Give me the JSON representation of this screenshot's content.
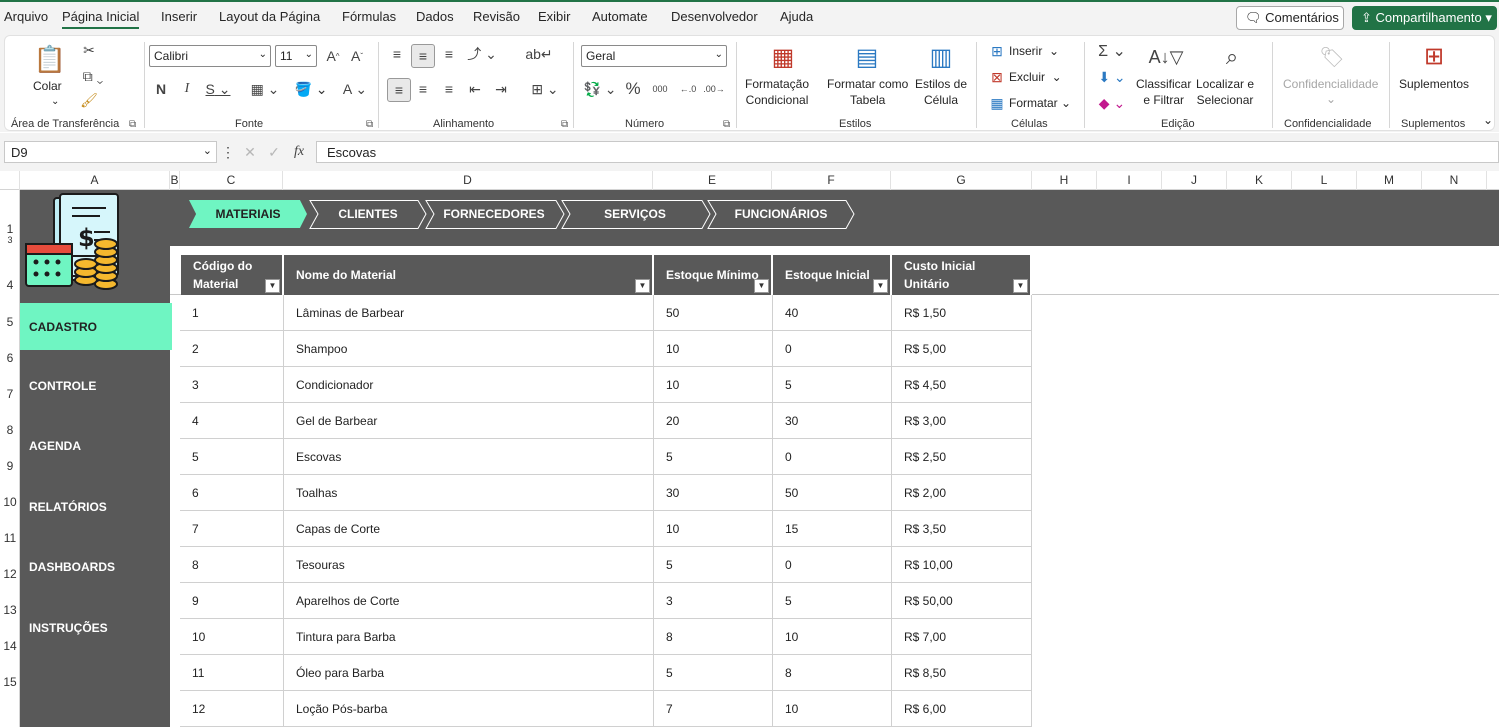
{
  "menu": {
    "items": [
      "Arquivo",
      "Página Inicial",
      "Inserir",
      "Layout da Página",
      "Fórmulas",
      "Dados",
      "Revisão",
      "Exibir",
      "Automate",
      "Desenvolvedor",
      "Ajuda"
    ],
    "active": "Página Inicial",
    "comments_label": "Comentários",
    "share_label": "Compartilhamento"
  },
  "ribbon": {
    "clipboard": {
      "paste": "Colar",
      "label": "Área de Transferência"
    },
    "font": {
      "name": "Calibri",
      "size": "11",
      "label": "Fonte",
      "bold": "N",
      "italic": "I",
      "underline": "S"
    },
    "alignment": {
      "label": "Alinhamento"
    },
    "number": {
      "format": "Geral",
      "label": "Número"
    },
    "styles": {
      "conditional": "Formatação\nCondicional",
      "as_table": "Formatar como\nTabela",
      "cell_styles": "Estilos de\nCélula",
      "label": "Estilos"
    },
    "cells": {
      "insert": "Inserir",
      "delete": "Excluir",
      "format": "Formatar",
      "label": "Células"
    },
    "editing": {
      "sort": "Classificar\ne Filtrar",
      "find": "Localizar e\nSelecionar",
      "label": "Edição"
    },
    "sensitivity": {
      "button": "Confidencialidade",
      "label": "Confidencialidade"
    },
    "addins": {
      "button": "Suplementos",
      "label": "Suplementos"
    }
  },
  "formula_bar": {
    "name_box": "D9",
    "value": "Escovas"
  },
  "columns": [
    "A",
    "B",
    "C",
    "D",
    "E",
    "F",
    "G",
    "H",
    "I",
    "J",
    "K",
    "L",
    "M",
    "N"
  ],
  "rows": [
    "1",
    "3",
    "4",
    "5",
    "6",
    "7",
    "8",
    "9",
    "10",
    "11",
    "12",
    "13",
    "14",
    "15"
  ],
  "nav_tabs": [
    "MATERIAIS",
    "CLIENTES",
    "FORNECEDORES",
    "SERVIÇOS",
    "FUNCIONÁRIOS"
  ],
  "active_tab": "MATERIAIS",
  "sidebar": [
    "CADASTRO",
    "CONTROLE",
    "AGENDA",
    "RELATÓRIOS",
    "DASHBOARDS",
    "INSTRUÇÕES"
  ],
  "active_sidebar": "CADASTRO",
  "table": {
    "headers": [
      "Código do Material",
      "Nome do Material",
      "Estoque Mínimo",
      "Estoque Inicial",
      "Custo Inicial Unitário"
    ],
    "rows": [
      [
        "1",
        "Lâminas de Barbear",
        "50",
        "40",
        "R$ 1,50"
      ],
      [
        "2",
        "Shampoo",
        "10",
        "0",
        "R$ 5,00"
      ],
      [
        "3",
        "Condicionador",
        "10",
        "5",
        "R$ 4,50"
      ],
      [
        "4",
        "Gel de Barbear",
        "20",
        "30",
        "R$ 3,00"
      ],
      [
        "5",
        "Escovas",
        "5",
        "0",
        "R$ 2,50"
      ],
      [
        "6",
        "Toalhas",
        "30",
        "50",
        "R$ 2,00"
      ],
      [
        "7",
        "Capas de Corte",
        "10",
        "15",
        "R$ 3,50"
      ],
      [
        "8",
        "Tesouras",
        "5",
        "0",
        "R$ 10,00"
      ],
      [
        "9",
        "Aparelhos de Corte",
        "3",
        "5",
        "R$ 50,00"
      ],
      [
        "10",
        "Tintura para Barba",
        "8",
        "10",
        "R$ 7,00"
      ],
      [
        "11",
        "Óleo para Barba",
        "5",
        "8",
        "R$ 8,50"
      ],
      [
        "12",
        "Loção Pós-barba",
        "7",
        "10",
        "R$ 6,00"
      ]
    ]
  },
  "colors": {
    "accent": "#6ff5c2",
    "dark": "#595959",
    "excel_green": "#217346"
  }
}
